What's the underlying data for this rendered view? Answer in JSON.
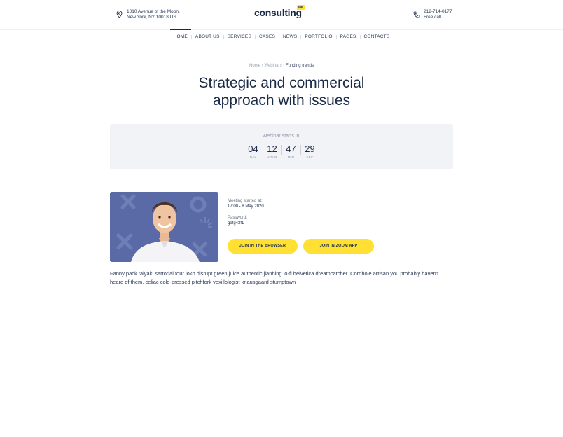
{
  "header": {
    "address_line1": "1010 Avenue of the Moon,",
    "address_line2": "New York, NY 10018 US.",
    "logo_text": "consulting",
    "logo_badge": "WP",
    "phone_number": "212-714-0177",
    "phone_label": "Free call"
  },
  "nav": {
    "items": [
      "HOME",
      "ABOUT US",
      "SERVICES",
      "CASES",
      "NEWS",
      "PORTFOLIO",
      "PAGES",
      "CONTACTS"
    ]
  },
  "breadcrumb": {
    "home": "Home",
    "sep": "›",
    "section": "Webinars",
    "current": "Funding trends"
  },
  "page": {
    "title_line1": "Strategic and commercial",
    "title_line2": "approach with issues"
  },
  "countdown": {
    "label": "Webinar starts in:",
    "units": [
      {
        "value": "04",
        "label": "DAY"
      },
      {
        "value": "12",
        "label": "HOUR"
      },
      {
        "value": "47",
        "label": "MIN"
      },
      {
        "value": "29",
        "label": "SEC"
      }
    ]
  },
  "meeting": {
    "started_label": "Meeting started at:",
    "started_value": "17:00 - 8 May 2020",
    "password_label": "Password:",
    "password_value": "gafg43f1",
    "join_browser": "JOIN IN THE BROWSER",
    "join_zoom": "JOIN IN ZOOM APP"
  },
  "description": "Fanny pack taiyaki sartorial four loko disrupt green juice authentic jianbing lo-fi helvetica dreamcatcher. Cornhole artisan you probably haven't heard of them, celiac cold-pressed pitchfork vexillologist knausgaard stumptown",
  "colors": {
    "accent": "#ffe033",
    "navy": "#1a2b47",
    "panel": "#f1f3f7",
    "photo_bg": "#5a6aa6"
  }
}
